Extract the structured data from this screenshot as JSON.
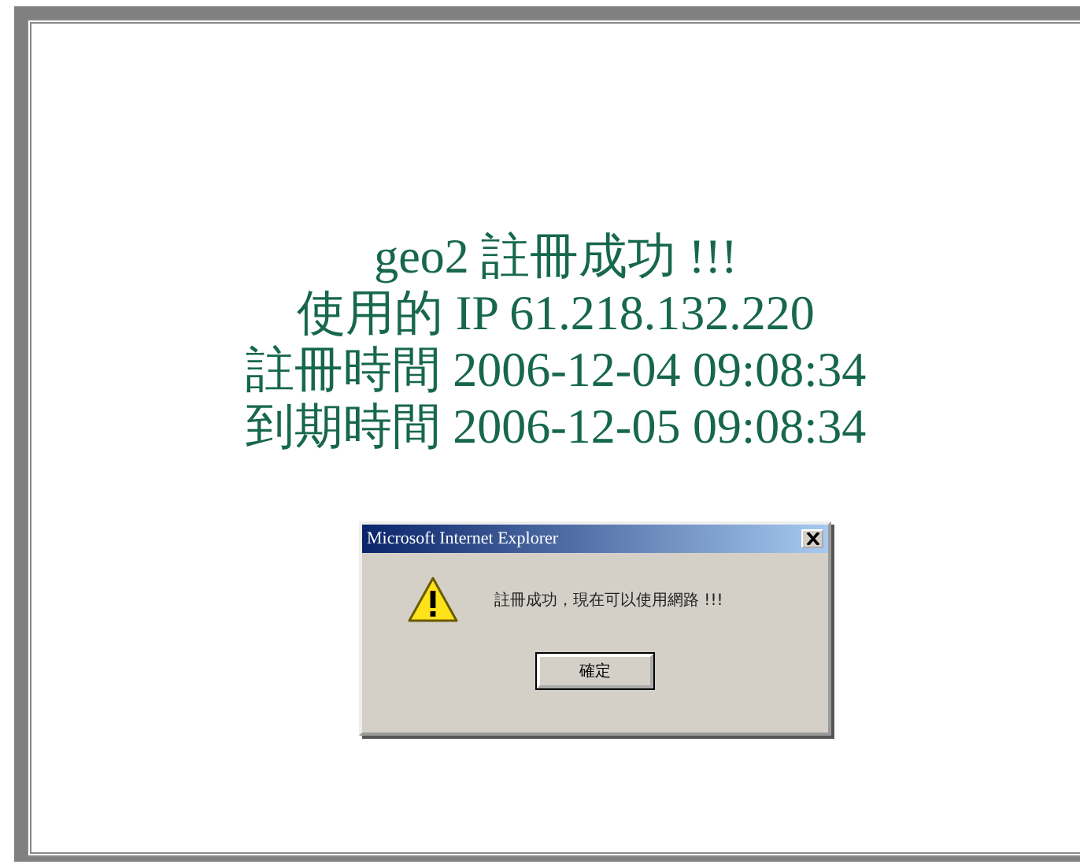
{
  "message_lines": [
    "geo2 註冊成功 !!!",
    "使用的 IP 61.218.132.220",
    "註冊時間 2006-12-04 09:08:34",
    "到期時間 2006-12-05 09:08:34"
  ],
  "dialog": {
    "title": "Microsoft Internet Explorer",
    "message": "註冊成功，現在可以使用網路 !!!",
    "buttons": [
      "確定"
    ]
  }
}
